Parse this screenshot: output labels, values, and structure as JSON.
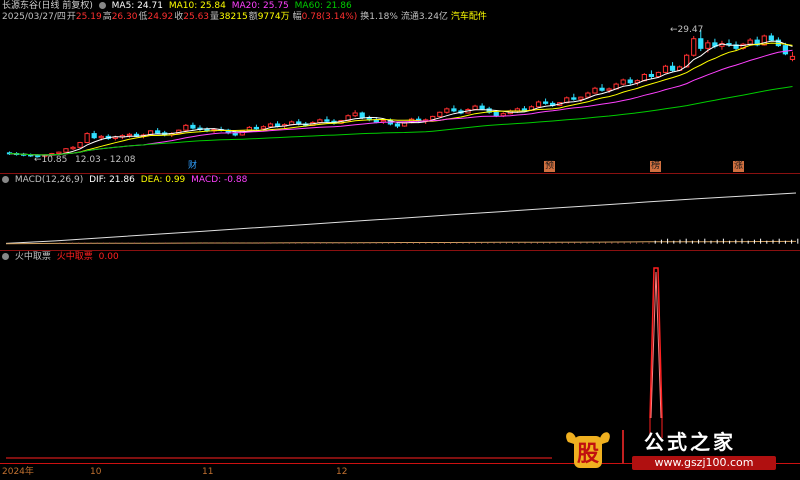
{
  "header": {
    "symbol": "长源东谷(日线 前复权)",
    "ma5": "MA5: 24.71",
    "ma10": "MA10: 25.84",
    "ma20": "MA20: 25.75",
    "ma60": "MA60: 21.86",
    "date": "2025/03/27/四",
    "open_label": "开",
    "open": "25.19",
    "high_label": "高",
    "high": "26.30",
    "low_label": "低",
    "low": "24.92",
    "close_label": "收",
    "close": "25.63",
    "vol_label": "量",
    "vol": "38215",
    "amount_label": "额",
    "amount": "9774万",
    "amp_label": "幅",
    "amp": "0.78(3.14%)",
    "turnover": "换1.18%",
    "float_cap": "流通3.24亿",
    "sector": "汽车配件"
  },
  "colors": {
    "up": "#ff3030",
    "down": "#30e0ff",
    "ma5": "#ffffff",
    "ma10": "#ffff00",
    "ma20": "#ff40ff",
    "ma60": "#00cc00",
    "grid": "#8a1010",
    "warn": "#ff2020"
  },
  "annotations": {
    "max_price": "29.47",
    "min_price": "10.85",
    "range_label": "12.03 - 12.08",
    "events": [
      "财",
      "预",
      "榜",
      "涨"
    ]
  },
  "macd": {
    "title": "MACD(12,26,9)",
    "dif": "DIF: 21.86",
    "dea": "DEA: 0.99",
    "macd": "MACD: -0.88"
  },
  "indicator": {
    "title": "火中取票",
    "name": "火中取票",
    "value": "0.00"
  },
  "xaxis": {
    "labels": [
      "2024年",
      "10",
      "11",
      "12"
    ]
  },
  "watermark": {
    "logo_char": "股",
    "brand": "公式之家",
    "url": "www.gszj100.com"
  },
  "chart_data": [
    {
      "type": "candlestick",
      "title": "长源东谷(日线 前复权)",
      "x_ticks": [
        "2024年",
        "10",
        "11",
        "12"
      ],
      "ylim": [
        10.85,
        29.47
      ],
      "candles": [
        {
          "o": 11.6,
          "h": 11.8,
          "l": 11.3,
          "c": 11.5
        },
        {
          "o": 11.5,
          "h": 11.7,
          "l": 11.2,
          "c": 11.4
        },
        {
          "o": 11.4,
          "h": 11.6,
          "l": 11.1,
          "c": 11.3
        },
        {
          "o": 11.3,
          "h": 11.5,
          "l": 11.0,
          "c": 11.2
        },
        {
          "o": 11.2,
          "h": 11.4,
          "l": 10.9,
          "c": 11.1
        },
        {
          "o": 11.1,
          "h": 11.4,
          "l": 10.85,
          "c": 11.3
        },
        {
          "o": 11.3,
          "h": 11.6,
          "l": 11.1,
          "c": 11.5
        },
        {
          "o": 11.5,
          "h": 11.8,
          "l": 11.3,
          "c": 11.7
        },
        {
          "o": 11.7,
          "h": 12.3,
          "l": 11.6,
          "c": 12.2
        },
        {
          "o": 12.2,
          "h": 12.6,
          "l": 12.0,
          "c": 12.4
        },
        {
          "o": 12.4,
          "h": 13.2,
          "l": 12.3,
          "c": 13.1
        },
        {
          "o": 13.1,
          "h": 14.6,
          "l": 13.0,
          "c": 14.4
        },
        {
          "o": 14.4,
          "h": 14.8,
          "l": 13.6,
          "c": 13.8
        },
        {
          "o": 13.8,
          "h": 14.2,
          "l": 13.4,
          "c": 14.0
        },
        {
          "o": 14.0,
          "h": 14.3,
          "l": 13.5,
          "c": 13.7
        },
        {
          "o": 13.7,
          "h": 14.1,
          "l": 13.4,
          "c": 13.9
        },
        {
          "o": 13.9,
          "h": 14.3,
          "l": 13.6,
          "c": 14.1
        },
        {
          "o": 14.1,
          "h": 14.5,
          "l": 13.8,
          "c": 14.3
        },
        {
          "o": 14.3,
          "h": 14.6,
          "l": 13.9,
          "c": 14.0
        },
        {
          "o": 14.0,
          "h": 14.4,
          "l": 13.7,
          "c": 14.2
        },
        {
          "o": 14.2,
          "h": 14.9,
          "l": 14.1,
          "c": 14.8
        },
        {
          "o": 14.8,
          "h": 15.2,
          "l": 14.3,
          "c": 14.5
        },
        {
          "o": 14.5,
          "h": 14.8,
          "l": 14.0,
          "c": 14.2
        },
        {
          "o": 14.2,
          "h": 14.6,
          "l": 13.9,
          "c": 14.4
        },
        {
          "o": 14.4,
          "h": 15.0,
          "l": 14.3,
          "c": 14.9
        },
        {
          "o": 14.9,
          "h": 15.8,
          "l": 14.7,
          "c": 15.6
        },
        {
          "o": 15.6,
          "h": 16.0,
          "l": 15.0,
          "c": 15.2
        },
        {
          "o": 15.2,
          "h": 15.6,
          "l": 14.8,
          "c": 15.0
        },
        {
          "o": 15.0,
          "h": 15.3,
          "l": 14.6,
          "c": 14.8
        },
        {
          "o": 14.8,
          "h": 15.2,
          "l": 14.5,
          "c": 15.0
        },
        {
          "o": 15.0,
          "h": 15.4,
          "l": 14.7,
          "c": 14.9
        },
        {
          "o": 14.9,
          "h": 15.1,
          "l": 14.3,
          "c": 14.5
        },
        {
          "o": 14.5,
          "h": 14.8,
          "l": 14.0,
          "c": 14.2
        },
        {
          "o": 14.2,
          "h": 14.9,
          "l": 14.1,
          "c": 14.8
        },
        {
          "o": 14.8,
          "h": 15.5,
          "l": 14.7,
          "c": 15.3
        },
        {
          "o": 15.3,
          "h": 15.7,
          "l": 14.9,
          "c": 15.1
        },
        {
          "o": 15.1,
          "h": 15.6,
          "l": 14.8,
          "c": 15.4
        },
        {
          "o": 15.4,
          "h": 16.0,
          "l": 15.2,
          "c": 15.8
        },
        {
          "o": 15.8,
          "h": 16.2,
          "l": 15.3,
          "c": 15.5
        },
        {
          "o": 15.5,
          "h": 15.9,
          "l": 15.1,
          "c": 15.7
        },
        {
          "o": 15.7,
          "h": 16.3,
          "l": 15.6,
          "c": 16.1
        },
        {
          "o": 16.1,
          "h": 16.5,
          "l": 15.6,
          "c": 15.8
        },
        {
          "o": 15.8,
          "h": 16.1,
          "l": 15.4,
          "c": 15.6
        },
        {
          "o": 15.6,
          "h": 16.2,
          "l": 15.5,
          "c": 16.0
        },
        {
          "o": 16.0,
          "h": 16.6,
          "l": 15.8,
          "c": 16.4
        },
        {
          "o": 16.4,
          "h": 16.9,
          "l": 16.0,
          "c": 16.2
        },
        {
          "o": 16.2,
          "h": 16.5,
          "l": 15.7,
          "c": 15.9
        },
        {
          "o": 15.9,
          "h": 16.4,
          "l": 15.8,
          "c": 16.3
        },
        {
          "o": 16.3,
          "h": 17.2,
          "l": 16.2,
          "c": 17.0
        },
        {
          "o": 17.0,
          "h": 17.8,
          "l": 16.8,
          "c": 17.4
        },
        {
          "o": 17.4,
          "h": 17.6,
          "l": 16.5,
          "c": 16.7
        },
        {
          "o": 16.7,
          "h": 17.0,
          "l": 16.2,
          "c": 16.4
        },
        {
          "o": 16.4,
          "h": 16.8,
          "l": 15.9,
          "c": 16.1
        },
        {
          "o": 16.1,
          "h": 16.5,
          "l": 15.8,
          "c": 16.3
        },
        {
          "o": 16.3,
          "h": 16.6,
          "l": 15.6,
          "c": 15.8
        },
        {
          "o": 15.8,
          "h": 16.0,
          "l": 15.2,
          "c": 15.5
        },
        {
          "o": 15.5,
          "h": 16.1,
          "l": 15.4,
          "c": 16.0
        },
        {
          "o": 16.0,
          "h": 16.7,
          "l": 15.9,
          "c": 16.5
        },
        {
          "o": 16.5,
          "h": 16.9,
          "l": 16.0,
          "c": 16.2
        },
        {
          "o": 16.2,
          "h": 16.6,
          "l": 15.8,
          "c": 16.4
        },
        {
          "o": 16.4,
          "h": 17.0,
          "l": 16.3,
          "c": 16.9
        },
        {
          "o": 16.9,
          "h": 17.6,
          "l": 16.8,
          "c": 17.5
        },
        {
          "o": 17.5,
          "h": 18.2,
          "l": 17.3,
          "c": 18.0
        },
        {
          "o": 18.0,
          "h": 18.5,
          "l": 17.5,
          "c": 17.7
        },
        {
          "o": 17.7,
          "h": 18.0,
          "l": 17.2,
          "c": 17.4
        },
        {
          "o": 17.4,
          "h": 18.1,
          "l": 17.3,
          "c": 17.9
        },
        {
          "o": 17.9,
          "h": 18.6,
          "l": 17.8,
          "c": 18.4
        },
        {
          "o": 18.4,
          "h": 18.8,
          "l": 17.8,
          "c": 18.0
        },
        {
          "o": 18.0,
          "h": 18.3,
          "l": 17.3,
          "c": 17.5
        },
        {
          "o": 17.5,
          "h": 17.8,
          "l": 16.8,
          "c": 17.0
        },
        {
          "o": 17.0,
          "h": 17.5,
          "l": 16.8,
          "c": 17.3
        },
        {
          "o": 17.3,
          "h": 17.9,
          "l": 17.2,
          "c": 17.7
        },
        {
          "o": 17.7,
          "h": 18.2,
          "l": 17.4,
          "c": 18.0
        },
        {
          "o": 18.0,
          "h": 18.4,
          "l": 17.6,
          "c": 17.8
        },
        {
          "o": 17.8,
          "h": 18.5,
          "l": 17.7,
          "c": 18.3
        },
        {
          "o": 18.3,
          "h": 19.2,
          "l": 18.2,
          "c": 19.0
        },
        {
          "o": 19.0,
          "h": 19.5,
          "l": 18.6,
          "c": 18.8
        },
        {
          "o": 18.8,
          "h": 19.1,
          "l": 18.3,
          "c": 18.5
        },
        {
          "o": 18.5,
          "h": 19.0,
          "l": 18.4,
          "c": 18.9
        },
        {
          "o": 18.9,
          "h": 19.8,
          "l": 18.8,
          "c": 19.6
        },
        {
          "o": 19.6,
          "h": 20.2,
          "l": 19.2,
          "c": 19.4
        },
        {
          "o": 19.4,
          "h": 19.8,
          "l": 19.0,
          "c": 19.7
        },
        {
          "o": 19.7,
          "h": 20.5,
          "l": 19.6,
          "c": 20.3
        },
        {
          "o": 20.3,
          "h": 21.2,
          "l": 20.2,
          "c": 21.0
        },
        {
          "o": 21.0,
          "h": 21.6,
          "l": 20.5,
          "c": 20.7
        },
        {
          "o": 20.7,
          "h": 21.1,
          "l": 20.3,
          "c": 20.9
        },
        {
          "o": 20.9,
          "h": 21.8,
          "l": 20.8,
          "c": 21.6
        },
        {
          "o": 21.6,
          "h": 22.4,
          "l": 21.4,
          "c": 22.2
        },
        {
          "o": 22.2,
          "h": 22.6,
          "l": 21.5,
          "c": 21.8
        },
        {
          "o": 21.8,
          "h": 22.3,
          "l": 21.4,
          "c": 22.1
        },
        {
          "o": 22.1,
          "h": 23.2,
          "l": 22.0,
          "c": 23.0
        },
        {
          "o": 23.0,
          "h": 23.6,
          "l": 22.4,
          "c": 22.7
        },
        {
          "o": 22.7,
          "h": 23.4,
          "l": 22.5,
          "c": 23.3
        },
        {
          "o": 23.3,
          "h": 24.4,
          "l": 23.2,
          "c": 24.2
        },
        {
          "o": 24.2,
          "h": 24.8,
          "l": 23.4,
          "c": 23.6
        },
        {
          "o": 23.6,
          "h": 24.3,
          "l": 23.5,
          "c": 24.1
        },
        {
          "o": 24.1,
          "h": 26.0,
          "l": 24.0,
          "c": 25.8
        },
        {
          "o": 25.8,
          "h": 28.6,
          "l": 25.6,
          "c": 28.2
        },
        {
          "o": 28.2,
          "h": 29.47,
          "l": 26.4,
          "c": 26.8
        },
        {
          "o": 26.8,
          "h": 28.0,
          "l": 26.2,
          "c": 27.6
        },
        {
          "o": 27.6,
          "h": 28.2,
          "l": 26.8,
          "c": 27.1
        },
        {
          "o": 27.1,
          "h": 27.9,
          "l": 26.6,
          "c": 27.5
        },
        {
          "o": 27.5,
          "h": 28.1,
          "l": 27.0,
          "c": 27.3
        },
        {
          "o": 27.3,
          "h": 27.8,
          "l": 26.5,
          "c": 26.8
        },
        {
          "o": 26.8,
          "h": 27.6,
          "l": 26.6,
          "c": 27.4
        },
        {
          "o": 27.4,
          "h": 28.3,
          "l": 27.2,
          "c": 28.0
        },
        {
          "o": 28.0,
          "h": 28.5,
          "l": 27.1,
          "c": 27.3
        },
        {
          "o": 27.3,
          "h": 28.8,
          "l": 27.2,
          "c": 28.6
        },
        {
          "o": 28.6,
          "h": 29.0,
          "l": 27.8,
          "c": 28.0
        },
        {
          "o": 28.0,
          "h": 28.4,
          "l": 27.0,
          "c": 27.2
        },
        {
          "o": 27.2,
          "h": 27.6,
          "l": 25.8,
          "c": 26.0
        },
        {
          "o": 25.19,
          "h": 26.3,
          "l": 24.92,
          "c": 25.63
        }
      ],
      "moving_averages": [
        {
          "name": "MA5",
          "color": "#ffffff",
          "value": 24.71
        },
        {
          "name": "MA10",
          "color": "#ffff00",
          "value": 25.84
        },
        {
          "name": "MA20",
          "color": "#ff40ff",
          "value": 25.75
        },
        {
          "name": "MA60",
          "color": "#00cc00",
          "value": 21.86
        }
      ]
    },
    {
      "type": "line",
      "title": "MACD(12,26,9)",
      "series": [
        {
          "name": "DIF",
          "values": [
            0.1,
            1.2,
            2.6,
            4.0,
            5.4,
            6.8,
            8.2,
            9.6,
            11.0,
            12.4,
            13.8,
            15.2,
            16.6,
            18.0,
            19.4,
            20.6,
            21.86
          ]
        },
        {
          "name": "DEA",
          "values": [
            0.0,
            0.1,
            0.2,
            0.2,
            0.3,
            0.3,
            0.4,
            0.4,
            0.5,
            0.5,
            0.6,
            0.6,
            0.7,
            0.8,
            0.8,
            0.9,
            0.99
          ]
        }
      ],
      "last_values": {
        "DIF": 21.86,
        "DEA": 0.99,
        "MACD": -0.88
      }
    },
    {
      "type": "line",
      "title": "火中取票",
      "series": [
        {
          "name": "火中取票",
          "values": [
            0,
            0,
            0,
            0,
            0,
            0,
            0,
            0,
            0,
            0,
            0,
            0,
            0,
            0,
            0,
            0,
            0,
            0,
            0,
            0,
            1,
            0,
            0,
            0,
            0
          ]
        }
      ],
      "last_value": 0.0
    }
  ]
}
